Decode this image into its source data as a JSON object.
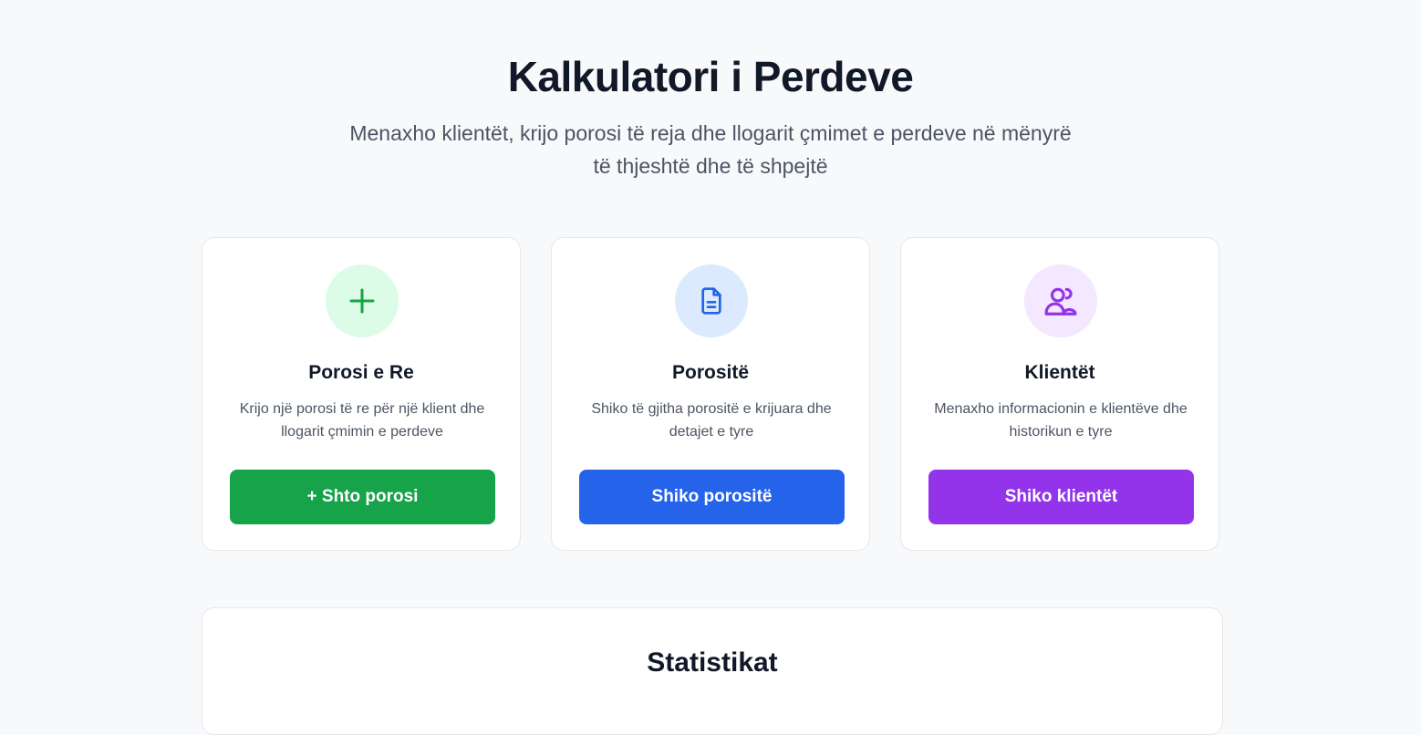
{
  "hero": {
    "title": "Kalkulatori i Perdeve",
    "subtitle": "Menaxho klientët, krijo porosi të reja dhe llogarit çmimet e perdeve në mënyrë të thjeshtë dhe të shpejtë"
  },
  "cards": [
    {
      "icon": "plus-icon",
      "title": "Porosi e Re",
      "description": "Krijo një porosi të re për një klient dhe llogarit çmimin e perdeve",
      "button_label": "+ Shto porosi",
      "accent": "#16a34a",
      "icon_bg": "#dcfce7"
    },
    {
      "icon": "document-icon",
      "title": "Porositë",
      "description": "Shiko të gjitha porositë e krijuara dhe detajet e tyre",
      "button_label": "Shiko porositë",
      "accent": "#2563eb",
      "icon_bg": "#dbeafe"
    },
    {
      "icon": "users-icon",
      "title": "Klientët",
      "description": "Menaxho informacionin e klientëve dhe historikun e tyre",
      "button_label": "Shiko klientët",
      "accent": "#9333ea",
      "icon_bg": "#f3e8ff"
    }
  ],
  "stats": {
    "title": "Statistikat"
  }
}
